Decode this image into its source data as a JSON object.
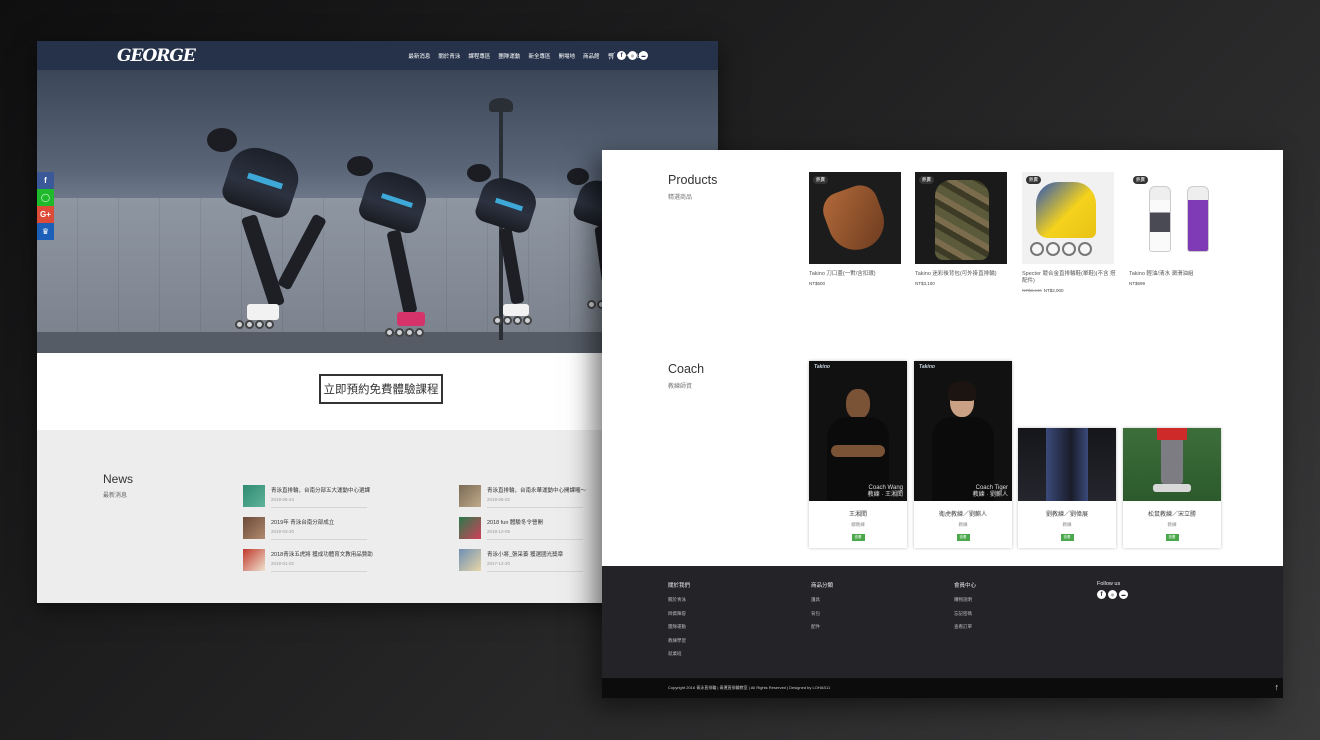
{
  "left_site": {
    "logo": "GEORGE",
    "menu": [
      "最新消息",
      "關於青泳",
      "課程專區",
      "團隊運動",
      "新全專區",
      "開場地",
      "商品館"
    ],
    "cart_icon": "cart-icon",
    "login": "登出",
    "social": [
      "f",
      "ig",
      "●"
    ],
    "share_bar": [
      {
        "label": "f",
        "color": "#3b5998"
      },
      {
        "label": "◯",
        "color": "#1fba2b"
      },
      {
        "label": "G+",
        "color": "#dd4b39"
      },
      {
        "label": "♛",
        "color": "#1b5fb8"
      }
    ],
    "cta": "立即預約免費體驗課程",
    "news_title": "News",
    "news_sub": "最新消息",
    "news": [
      {
        "text": "青泳直排輪，台南分部五大運動中心選課",
        "date": "2019-06-24"
      },
      {
        "text": "2019年 青泳台南分部成立",
        "date": "2019-03-20"
      },
      {
        "text": "2018青泳五虎將 獲成功體育文教用品贊助",
        "date": "2019-01-02"
      },
      {
        "text": "青泳直排輪，台南永華運動中心開課囉～",
        "date": "2019-06-02"
      },
      {
        "text": "2018 fun 體驗冬令營開",
        "date": "2018-12-05"
      },
      {
        "text": "青泳小將_張采蓁 獲選國光獎章",
        "date": "2017-12-20"
      }
    ]
  },
  "right_site": {
    "products_title": "Products",
    "products_sub": "精選商品",
    "products": [
      {
        "badge": "熱賣",
        "name": "Takino 刀口蓋(一對/含扣環)",
        "price": "NT$600",
        "old_price": ""
      },
      {
        "badge": "熱賣",
        "name": "Takino 迷彩後背包(可外掛直排輪)",
        "price": "NT$3,100",
        "old_price": ""
      },
      {
        "badge": "熱賣",
        "name": "Specter 競合金直排輪鞋(單鞋)(不含 搭配件)",
        "price": "NT$2,000",
        "old_price": "NT$3,440"
      },
      {
        "badge": "熱賣",
        "name": "Takino 輕油/清水 潤滑油組",
        "price": "NT$699",
        "old_price": ""
      }
    ],
    "coach_title": "Coach",
    "coach_sub": "教練師資",
    "coaches": [
      {
        "name": "王湘閎",
        "role": "總教練",
        "brand": "Takino",
        "sig": "Coach Wang\n教練 · 王湘閎",
        "btn": "查看"
      },
      {
        "name": "衛虎教練／劉麒人",
        "role": "教練",
        "brand": "Takino",
        "sig": "Coach Tiger\n教練 · 劉麒人",
        "btn": "查看"
      },
      {
        "name": "劉教練／劉偉展",
        "role": "教練",
        "brand": "",
        "sig": "",
        "btn": "查看"
      },
      {
        "name": "松鼠教練／宋立勝",
        "role": "教練",
        "brand": "",
        "sig": "",
        "btn": "查看"
      }
    ],
    "footer": {
      "col1": {
        "head": "關於我們",
        "links": [
          "關於青泳",
          "師資陣容",
          "團隊運動",
          "教練學習",
          "就業班"
        ]
      },
      "col2": {
        "head": "商品分類",
        "links": [
          "護具",
          "背包",
          "配件"
        ]
      },
      "col3": {
        "head": "會員中心",
        "links": [
          "購物說明",
          "忘記密碼",
          "查看訂單"
        ]
      },
      "col4": {
        "head": "Follow us",
        "social": [
          "f",
          "ig",
          "●"
        ]
      }
    },
    "copyright": "Copyright 2016 青泳直排輪 | 青運直排輪教室 | All Rights Reserved | Designed by LOHAS11",
    "top_arrow": "↑"
  }
}
